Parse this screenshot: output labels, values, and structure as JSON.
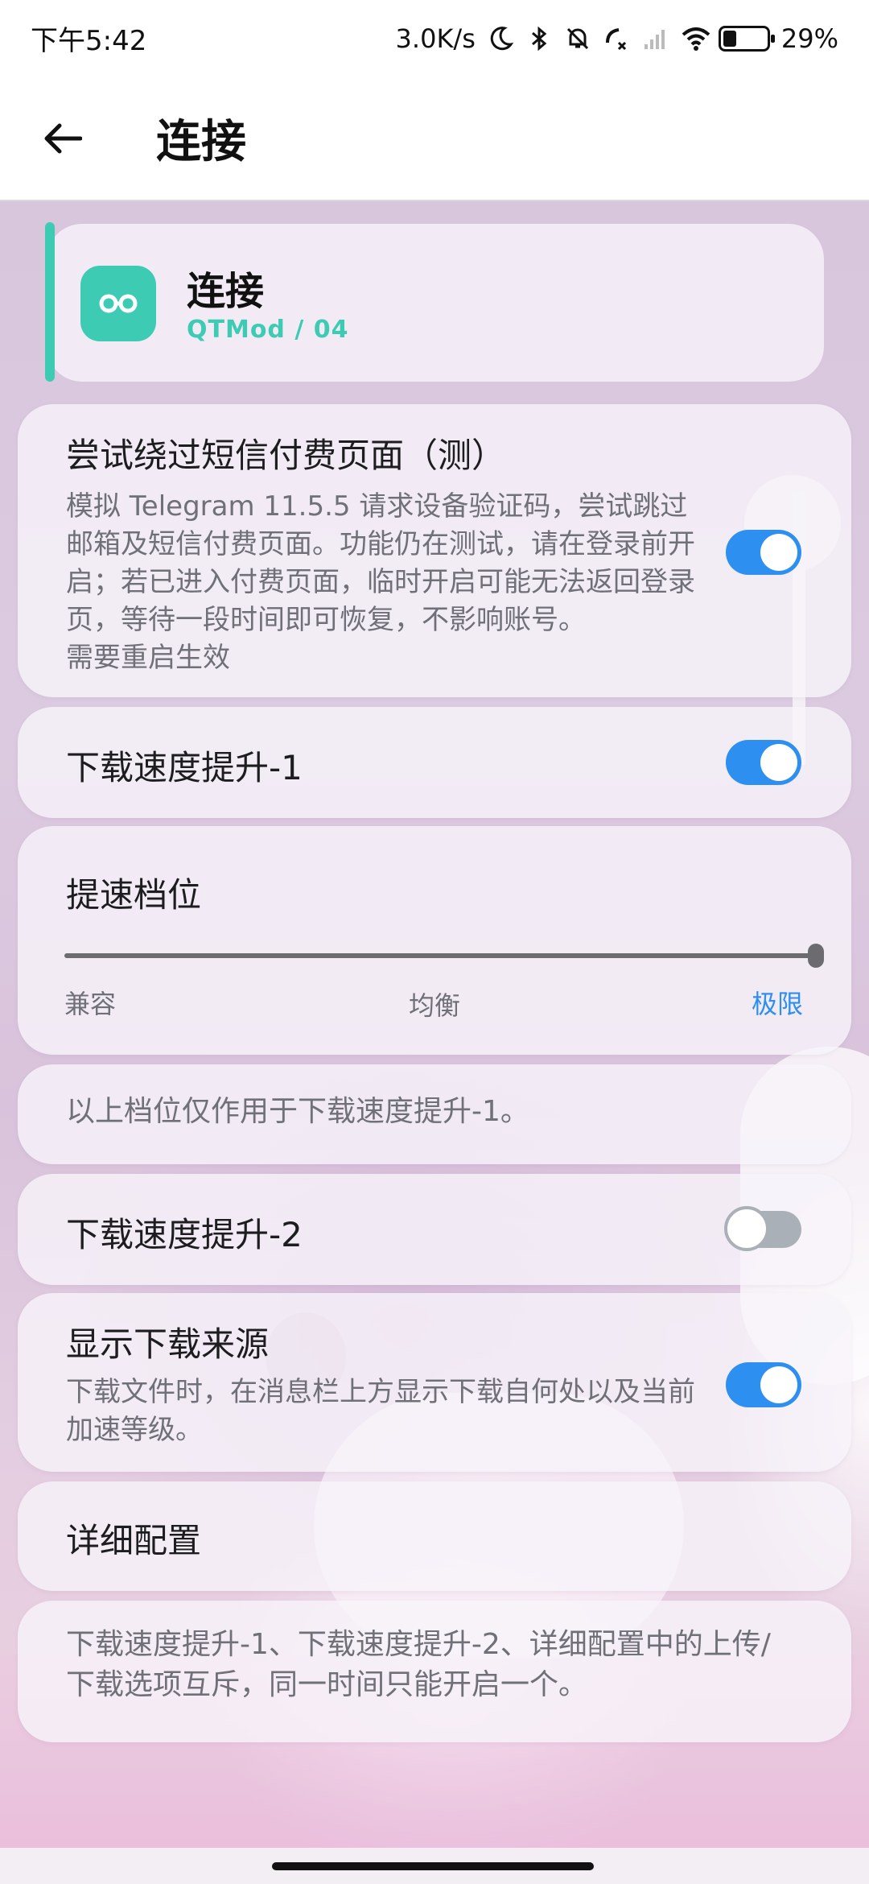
{
  "status_bar": {
    "time": "下午5:42",
    "net_speed": "3.0K/s",
    "battery_pct": "29%",
    "battery_level": 0.29
  },
  "app_bar": {
    "title": "连接",
    "back_icon": "arrow-left-icon"
  },
  "header": {
    "title": "连接",
    "subtitle": "QTMod  /  04",
    "icon": "infinity-icon",
    "accent_color": "#3dcbb3"
  },
  "settings": {
    "bypass_sms": {
      "title": "尝试绕过短信付费页面（测）",
      "desc_lines": [
        "模拟 Telegram 11.5.5 请求设备验证码，尝试跳过",
        "邮箱及短信付费页面。功能仍在测试，请在登录前开",
        "启；若已进入付费页面，临时开启可能无法返回登录",
        "页，等待一段时间即可恢复，不影响账号。",
        "需要重启生效"
      ],
      "enabled": true
    },
    "speed_boost_1": {
      "title": "下载速度提升-1",
      "enabled": true
    },
    "boost_level": {
      "title": "提速档位",
      "labels": [
        "兼容",
        "均衡",
        "极限"
      ],
      "selected": "极限",
      "value": 1.0
    },
    "boost_level_note": "以上档位仅作用于下载速度提升-1。",
    "speed_boost_2": {
      "title": "下载速度提升-2",
      "enabled": false
    },
    "show_source": {
      "title": "显示下载来源",
      "desc_lines": [
        "下载文件时，在消息栏上方显示下载自何处以及当前",
        "加速等级。"
      ],
      "enabled": true
    },
    "detail_config": {
      "title": "详细配置"
    },
    "footer_note_lines": [
      "下载速度提升-1、下载速度提升-2、详细配置中的上传/",
      "下载选项互斥，同一时间只能开启一个。"
    ]
  },
  "colors": {
    "toggle_on": "#2d8ff0",
    "toggle_off": "#aab0b8",
    "accent": "#3dcbb3"
  }
}
